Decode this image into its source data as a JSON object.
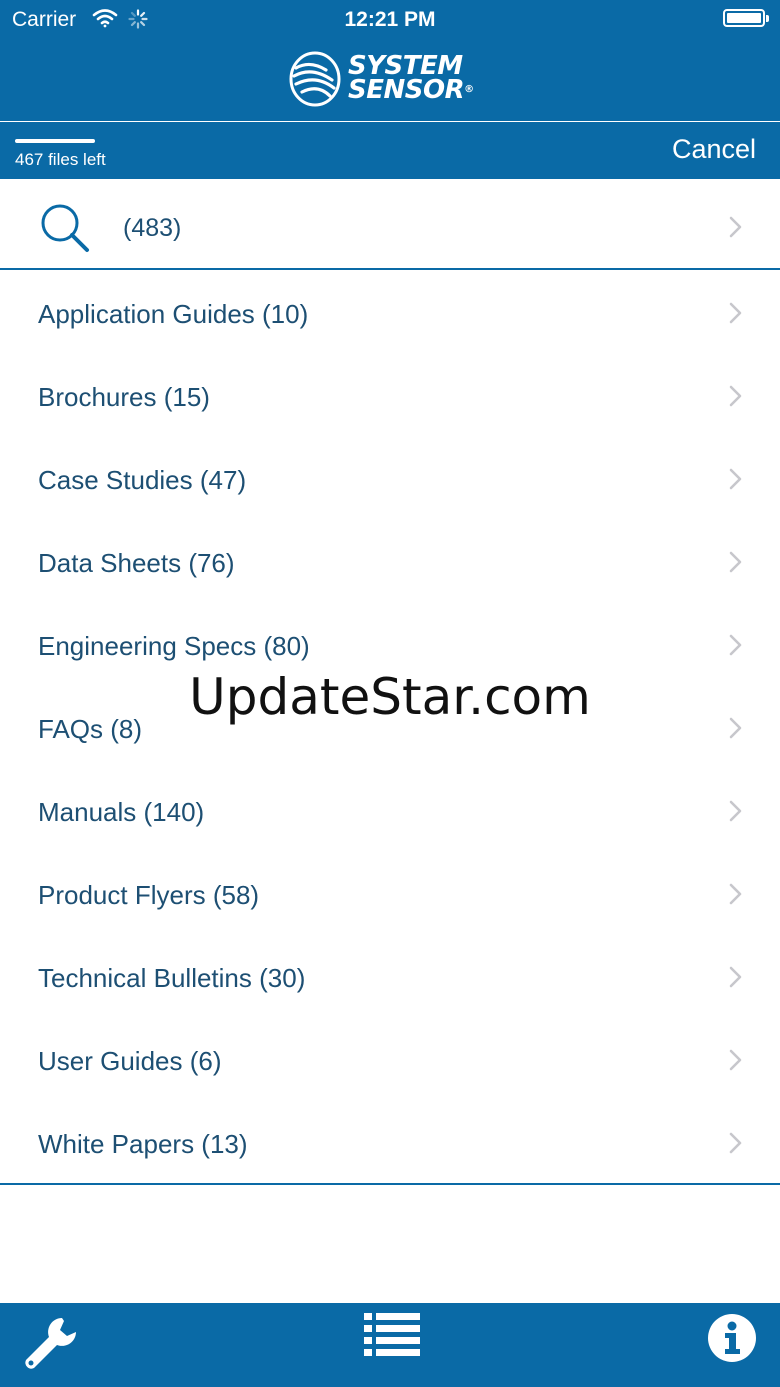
{
  "status_bar": {
    "carrier": "Carrier",
    "time": "12:21 PM",
    "icons": [
      "wifi-icon",
      "activity-spinner-icon",
      "battery-icon"
    ]
  },
  "header": {
    "logo_line1": "SYSTEM",
    "logo_line2": "SENSOR",
    "logo_reg": "®"
  },
  "download": {
    "files_left": "467 files left",
    "progress": 0.1,
    "cancel_label": "Cancel"
  },
  "search": {
    "count": "(483)",
    "icon": "search-icon"
  },
  "categories": [
    {
      "label": "Application Guides (10)"
    },
    {
      "label": "Brochures (15)"
    },
    {
      "label": "Case Studies (47)"
    },
    {
      "label": "Data Sheets (76)"
    },
    {
      "label": "Engineering Specs (80)"
    },
    {
      "label": "FAQs (8)"
    },
    {
      "label": "Manuals (140)"
    },
    {
      "label": "Product Flyers (58)"
    },
    {
      "label": "Technical Bulletins (30)"
    },
    {
      "label": "User Guides (6)"
    },
    {
      "label": "White Papers (13)"
    }
  ],
  "watermark": "UpdateStar.com",
  "tab_bar": {
    "icons": [
      "wrench-icon",
      "list-icon",
      "info-icon"
    ]
  },
  "colors": {
    "brand_blue": "#0a6aa6",
    "text_blue": "#1d4f73",
    "chevron": "#c7c7cc"
  }
}
